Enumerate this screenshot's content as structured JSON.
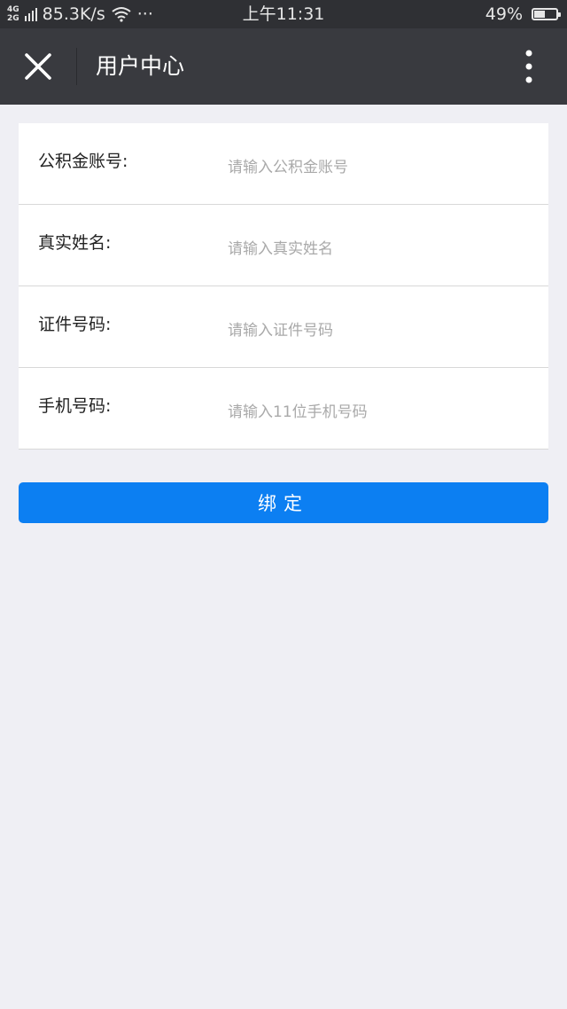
{
  "status_bar": {
    "network_top": "4G",
    "network_bottom": "2G",
    "speed": "85.3K/s",
    "more": "···",
    "time": "上午11:31",
    "battery_text": "49%",
    "battery_level": 0.49
  },
  "nav": {
    "title": "用户中心",
    "close_icon": "close-icon",
    "more_icon": "more-vertical-icon"
  },
  "form": {
    "rows": [
      {
        "label": "公积金账号:",
        "placeholder": "请输入公积金账号",
        "value": ""
      },
      {
        "label": "真实姓名:",
        "placeholder": "请输入真实姓名",
        "value": ""
      },
      {
        "label": "证件号码:",
        "placeholder": "请输入证件号码",
        "value": ""
      },
      {
        "label": "手机号码:",
        "placeholder": "请输入11位手机号码",
        "value": ""
      }
    ]
  },
  "bind_button": {
    "label": "绑定"
  },
  "colors": {
    "status_bar_bg": "#2f3034",
    "nav_bg": "#393a3f",
    "page_bg": "#efeff4",
    "primary_button": "#0c7ff2"
  }
}
